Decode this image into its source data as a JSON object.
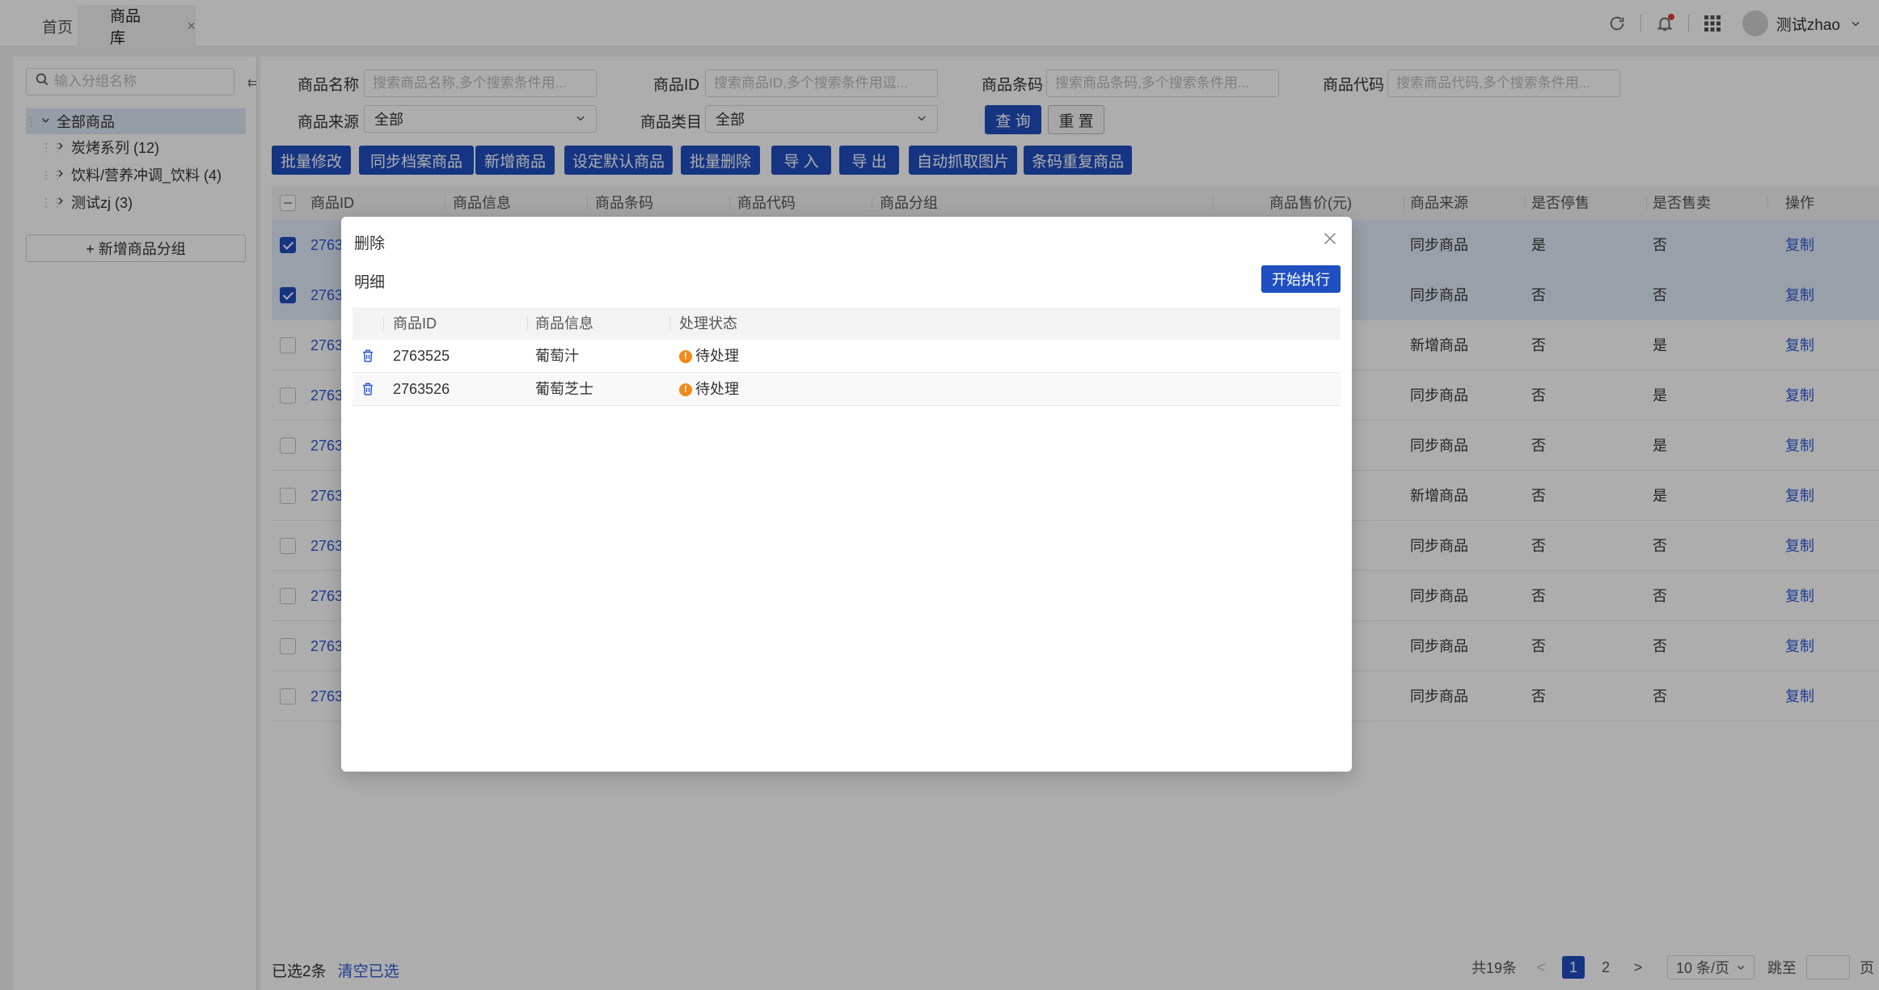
{
  "tabs": [
    {
      "label": "首页"
    },
    {
      "label": "商品库",
      "close": "×"
    }
  ],
  "header": {
    "username": "测试zhao"
  },
  "sidebar": {
    "search_placeholder": "输入分组名称",
    "tree": [
      {
        "label": "全部商品"
      },
      {
        "label": "炭烤系列 (12)"
      },
      {
        "label": "饮料/营养冲调_饮料 (4)"
      },
      {
        "label": "测试zj (3)"
      }
    ],
    "add_group_label": "+ 新增商品分组"
  },
  "filters": {
    "name_label": "商品名称",
    "name_placeholder": "搜索商品名称,多个搜索条件用...",
    "id_label": "商品ID",
    "id_placeholder": "搜索商品ID,多个搜索条件用逗...",
    "barcode_label": "商品条码",
    "barcode_placeholder": "搜索商品条码,多个搜索条件用...",
    "code_label": "商品代码",
    "code_placeholder": "搜索商品代码,多个搜索条件用...",
    "source_label": "商品来源",
    "source_value": "全部",
    "category_label": "商品类目",
    "category_value": "全部",
    "query_label": "查 询",
    "reset_label": "重 置"
  },
  "toolbar": [
    "批量修改",
    "同步档案商品",
    "新增商品",
    "设定默认商品",
    "批量删除",
    "导 入",
    "导 出",
    "自动抓取图片",
    "条码重复商品"
  ],
  "table": {
    "columns": [
      "商品ID",
      "商品信息",
      "商品条码",
      "商品代码",
      "商品分组",
      "商品售价(元)",
      "商品来源",
      "是否停售",
      "是否售卖",
      "操作"
    ],
    "rows": [
      {
        "id": "2763",
        "source": "同步商品",
        "stopped": "是",
        "selling": "否",
        "action": "复制",
        "selected": true
      },
      {
        "id": "2763",
        "source": "同步商品",
        "stopped": "否",
        "selling": "否",
        "action": "复制",
        "selected": true
      },
      {
        "id": "2763",
        "source": "新增商品",
        "stopped": "否",
        "selling": "是",
        "action": "复制",
        "selected": false
      },
      {
        "id": "2763",
        "source": "同步商品",
        "stopped": "否",
        "selling": "是",
        "action": "复制",
        "selected": false
      },
      {
        "id": "2763",
        "source": "同步商品",
        "stopped": "否",
        "selling": "是",
        "action": "复制",
        "selected": false
      },
      {
        "id": "2763",
        "source": "新增商品",
        "stopped": "否",
        "selling": "是",
        "action": "复制",
        "selected": false
      },
      {
        "id": "2763",
        "source": "同步商品",
        "stopped": "否",
        "selling": "否",
        "action": "复制",
        "selected": false
      },
      {
        "id": "2763",
        "source": "同步商品",
        "stopped": "否",
        "selling": "否",
        "action": "复制",
        "selected": false
      },
      {
        "id": "2763",
        "source": "同步商品",
        "stopped": "否",
        "selling": "否",
        "action": "复制",
        "selected": false
      },
      {
        "id": "2763",
        "source": "同步商品",
        "stopped": "否",
        "selling": "否",
        "action": "复制",
        "selected": false
      }
    ]
  },
  "footer": {
    "selected_text": "已选2条",
    "clear_label": "清空已选",
    "total": "共19条",
    "prev": "<",
    "pages": [
      "1",
      "2"
    ],
    "next": ">",
    "page_size": "10 条/页",
    "jump_label": "跳至",
    "page_unit": "页"
  },
  "modal": {
    "title": "删除",
    "subtitle": "明细",
    "run_label": "开始执行",
    "columns": [
      "商品ID",
      "商品信息",
      "处理状态"
    ],
    "rows": [
      {
        "id": "2763525",
        "info": "葡萄汁",
        "status": "待处理"
      },
      {
        "id": "2763526",
        "info": "葡萄芝士",
        "status": "待处理"
      }
    ],
    "warn_glyph": "!"
  },
  "colors": {
    "primary": "#1f4fc1",
    "link": "#2d5bd6",
    "warning": "#f08a1a"
  }
}
